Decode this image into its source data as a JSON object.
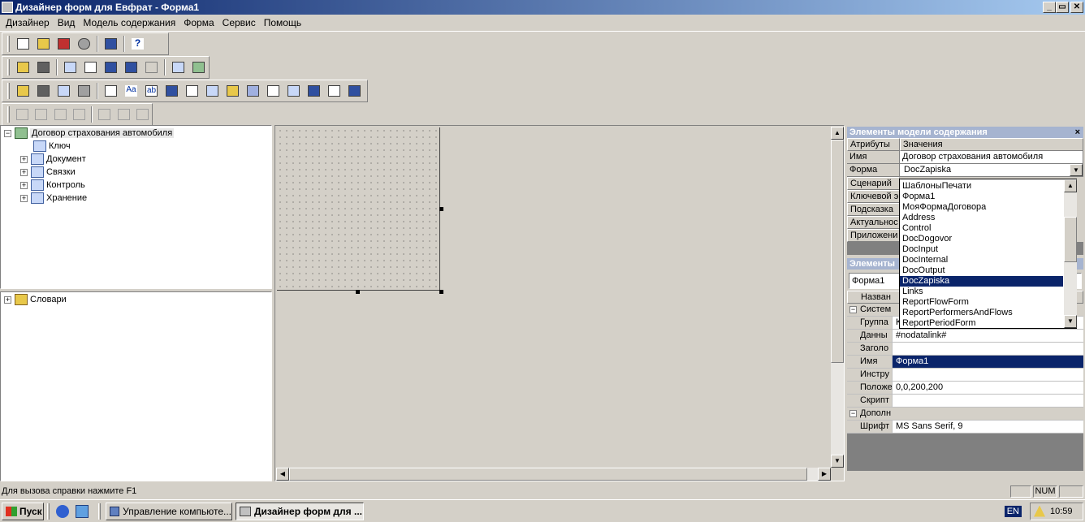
{
  "window": {
    "title": "Дизайнер форм для Евфрат - Форма1",
    "minimize": "_",
    "maximize": "▭",
    "close": "✕"
  },
  "menu": [
    "Дизайнер",
    "Вид",
    "Модель содержания",
    "Форма",
    "Сервис",
    "Помощь"
  ],
  "tree": {
    "root": "Договор страхования автомобиля",
    "children": [
      "Ключ",
      "Документ",
      "Связки",
      "Контроль",
      "Хранение"
    ],
    "dicts": "Словари"
  },
  "panel": {
    "title": "Элементы модели содержания",
    "col_attr": "Атрибуты",
    "col_val": "Значения",
    "rows": [
      {
        "k": "Имя",
        "v": "Договор страхования автомобиля"
      },
      {
        "k": "Форма",
        "v": "DocZapiska"
      },
      {
        "k": "Сценарий",
        "v": ""
      },
      {
        "k": "Ключевой э",
        "v": ""
      },
      {
        "k": "Подсказка",
        "v": ""
      },
      {
        "k": "Актуальнос",
        "v": ""
      },
      {
        "k": "Приложени",
        "v": ""
      }
    ],
    "close": "×"
  },
  "dropdown": {
    "items": [
      "ШаблоныПечати",
      "Форма1",
      "МояФормаДоговора",
      "Address",
      "Control",
      "DocDogovor",
      "DocInput",
      "DocInternal",
      "DocOutput",
      "DocZapiska",
      "Links",
      "ReportFlowForm",
      "ReportPerformersAndFlows",
      "ReportPeriodForm"
    ],
    "selected": "DocZapiska"
  },
  "elements": {
    "title": "Элементы",
    "combo_value": "Форма1",
    "header_name": "Назван",
    "group_system": "Систем",
    "group_extra": "Дополн",
    "props": [
      {
        "k": "Группа",
        "v": "Ka"
      },
      {
        "k": "Данны",
        "v": "#nodatalink#"
      },
      {
        "k": "Заголо",
        "v": ""
      },
      {
        "k": "Имя",
        "v": "Форма1"
      },
      {
        "k": "Инстру",
        "v": ""
      },
      {
        "k": "Положе",
        "v": "0,0,200,200"
      },
      {
        "k": "Скрипт",
        "v": ""
      }
    ],
    "font_key": "Шрифт",
    "font_val": "MS Sans Serif, 9"
  },
  "status": {
    "text": "Для вызова справки нажмите F1",
    "num": "NUM"
  },
  "taskbar": {
    "start": "Пуск",
    "tasks": [
      "Управление компьюте...",
      "Дизайнер форм для ..."
    ],
    "lang": "EN",
    "clock": "10:59"
  }
}
